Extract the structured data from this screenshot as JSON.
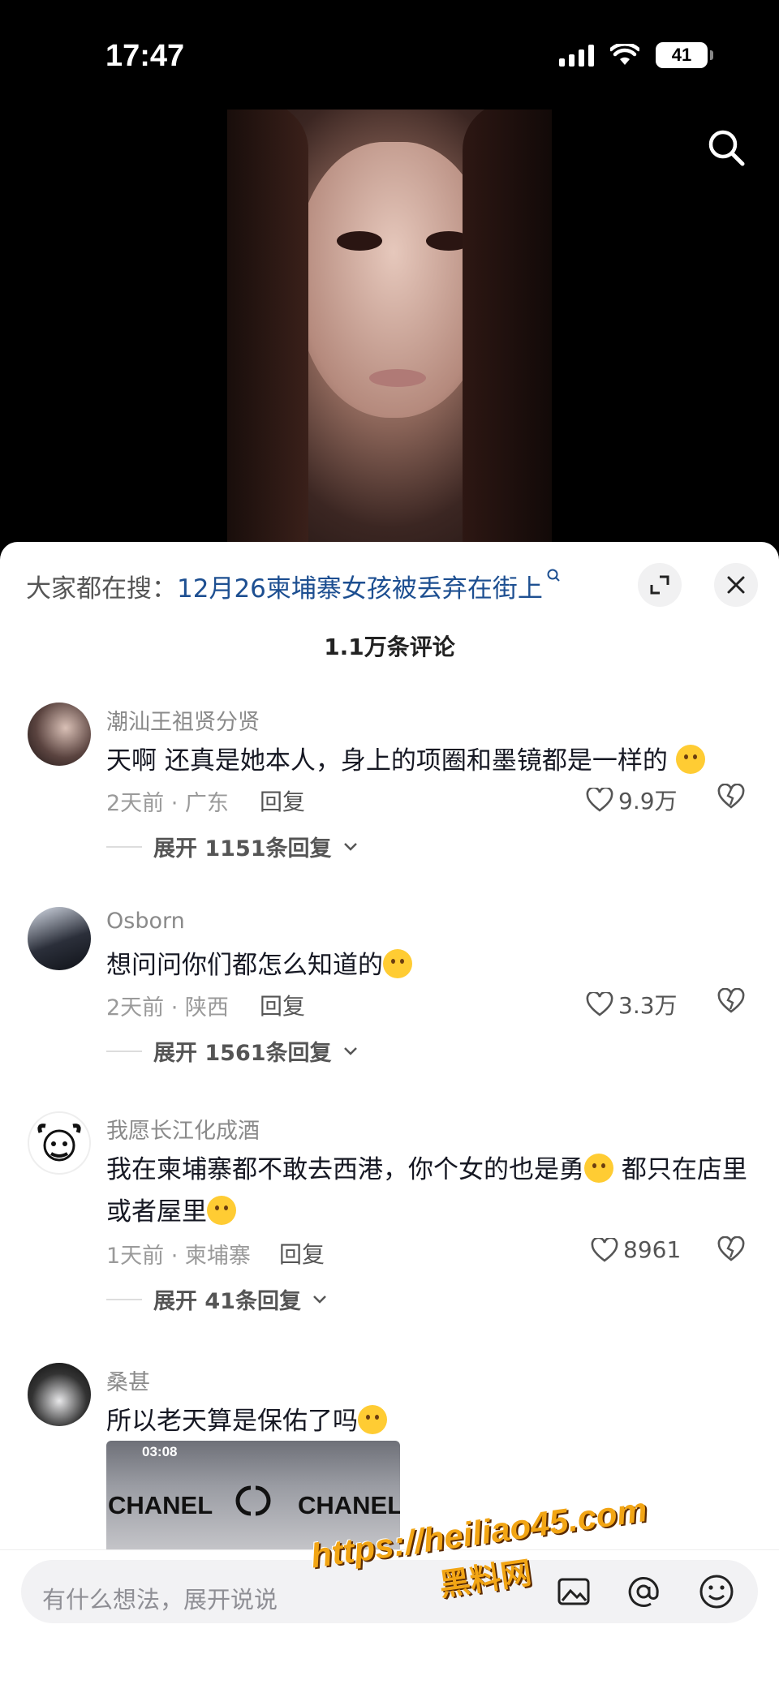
{
  "status_bar": {
    "time": "17:47",
    "battery": "41"
  },
  "hot_search": {
    "prefix": "大家都在搜：",
    "topic": "12月26柬埔寨女孩被丢弃在街上"
  },
  "comment_count": "1.1万条评论",
  "comments": [
    {
      "username": "潮汕王祖贤分贤",
      "text": "天啊 还真是她本人，身上的项圈和墨镜都是一样的",
      "time_location": "2天前 · 广东",
      "reply_label": "回复",
      "likes": "9.9万",
      "expand_label": "展开 1151条回复"
    },
    {
      "username": "Osborn",
      "text": "想问问你们都怎么知道的",
      "time_location": "2天前 · 陕西",
      "reply_label": "回复",
      "likes": "3.3万",
      "expand_label": "展开 1561条回复"
    },
    {
      "username": "我愿长江化成酒",
      "text_part1": "我在柬埔寨都不敢去西港，你个女的也是勇",
      "text_part2": " 都只在店里或者屋里",
      "time_location": "1天前 · 柬埔寨",
      "reply_label": "回复",
      "likes": "8961",
      "expand_label": "展开 41条回复"
    },
    {
      "username": "桑甚",
      "text": "所以老天算是保佑了吗",
      "thumb_time": "03:08",
      "thumb_brand_left": "CHANEL",
      "thumb_brand_right": "CHANEL"
    }
  ],
  "input": {
    "placeholder": "有什么想法，展开说说"
  },
  "watermark": {
    "url": "https://heiliao45.com",
    "name": "黑料网"
  },
  "colors": {
    "topic_link": "#1d4f91",
    "watermark": "#f2a514",
    "sheet": "#ffffff"
  },
  "icons": [
    "search-icon",
    "expand-icon",
    "close-icon",
    "heart-icon",
    "dislike-icon",
    "image-icon",
    "at-icon",
    "emoji-icon"
  ]
}
